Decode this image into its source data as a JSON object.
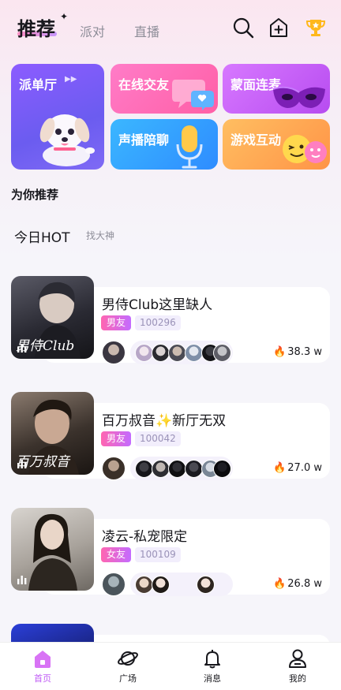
{
  "header": {
    "tabs": [
      {
        "label": "推荐",
        "active": true
      },
      {
        "label": "派对",
        "active": false
      },
      {
        "label": "直播",
        "active": false
      }
    ],
    "icons": [
      "search-icon",
      "add-room-icon",
      "trophy-icon"
    ]
  },
  "banners": [
    {
      "label": "派单厅",
      "icon": "puppy-icon"
    },
    {
      "label": "在线交友",
      "icon": "chat-bubble-icon"
    },
    {
      "label": "蒙面连麦",
      "icon": "mask-icon"
    },
    {
      "label": "声播陪聊",
      "icon": "microphone-icon"
    },
    {
      "label": "游戏互动",
      "icon": "emoji-icon"
    }
  ],
  "section_title": "为你推荐",
  "hot": {
    "title": "今日HOT",
    "subtitle": "找大神"
  },
  "rooms": [
    {
      "title": "男侍Club这里缺人",
      "tag": "男友",
      "id": "100296",
      "heat": "38.3 w",
      "cover_text": "男侍Club"
    },
    {
      "title": "百万叔音✨新厅无双",
      "tag": "男友",
      "id": "100042",
      "heat": "27.0 w",
      "cover_text": "百万叔音"
    },
    {
      "title": "凌云-私宠限定",
      "tag": "女友",
      "id": "100109",
      "heat": "26.8 w",
      "cover_text": ""
    }
  ],
  "bottom_nav": [
    {
      "label": "首页",
      "active": true
    },
    {
      "label": "广场",
      "active": false
    },
    {
      "label": "消息",
      "active": false
    },
    {
      "label": "我的",
      "active": false
    }
  ],
  "colors": {
    "accent": "#c05cf5",
    "tag_gradient_start": "#ff66b1",
    "heat_fire": "#ff6a2b"
  }
}
